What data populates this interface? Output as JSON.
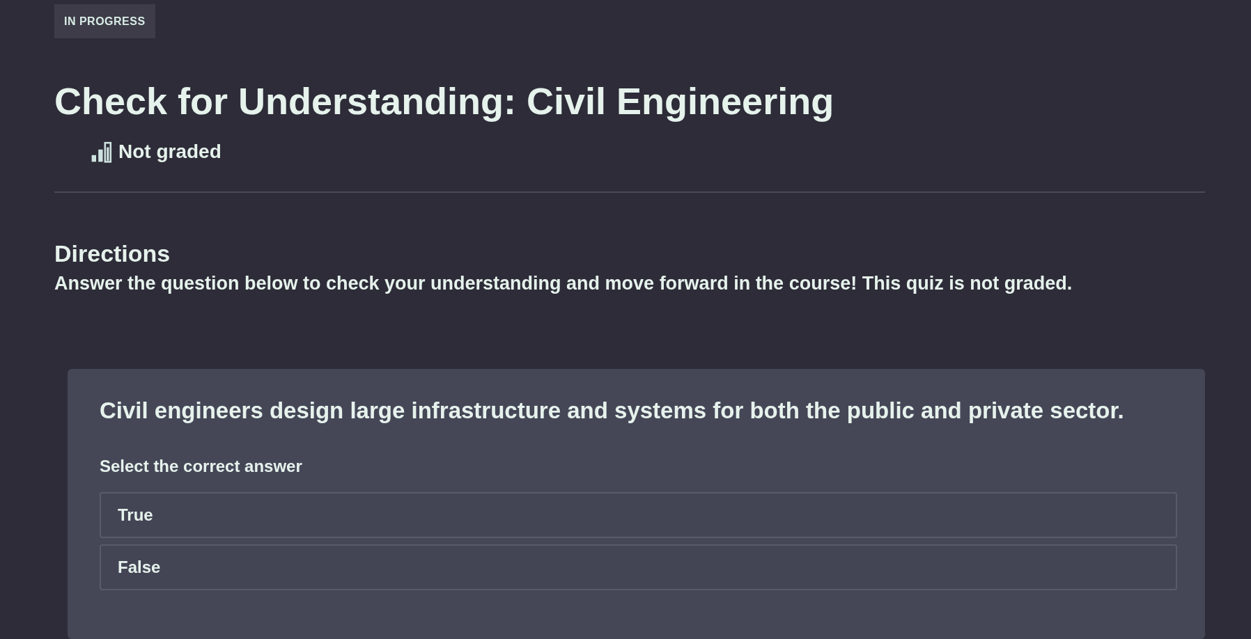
{
  "status_badge": "IN PROGRESS",
  "title": "Check for Understanding: Civil Engineering",
  "grading": {
    "label": "Not graded"
  },
  "directions": {
    "heading": "Directions",
    "text": "Answer the question below to check your understanding and move forward in the course! This quiz is not graded."
  },
  "question": {
    "prompt": "Civil engineers design large infrastructure and systems for both the public and private sector.",
    "instruction": "Select the correct answer",
    "options": [
      {
        "label": "True",
        "selected": false
      },
      {
        "label": "False",
        "selected": false
      }
    ]
  }
}
